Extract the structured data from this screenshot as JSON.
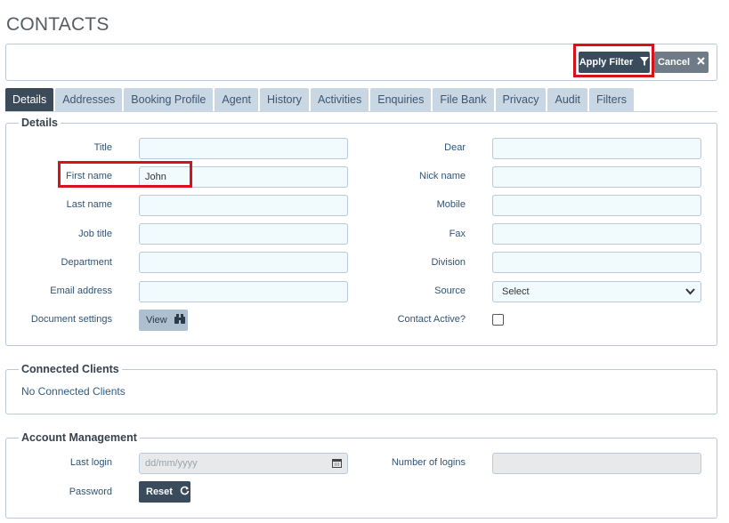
{
  "page": {
    "title": "CONTACTS"
  },
  "toolbar": {
    "apply_filter_label": "Apply Filter",
    "cancel_label": "Cancel"
  },
  "tabs": [
    {
      "label": "Details",
      "active": true
    },
    {
      "label": "Addresses"
    },
    {
      "label": "Booking Profile"
    },
    {
      "label": "Agent"
    },
    {
      "label": "History"
    },
    {
      "label": "Activities"
    },
    {
      "label": "Enquiries"
    },
    {
      "label": "File Bank"
    },
    {
      "label": "Privacy"
    },
    {
      "label": "Audit"
    },
    {
      "label": "Filters"
    }
  ],
  "details": {
    "legend": "Details",
    "title_label": "Title",
    "title_value": "",
    "first_name_label": "First name",
    "first_name_value": "John",
    "last_name_label": "Last name",
    "last_name_value": "",
    "job_title_label": "Job title",
    "job_title_value": "",
    "department_label": "Department",
    "department_value": "",
    "email_label": "Email address",
    "email_value": "",
    "document_settings_label": "Document settings",
    "view_button_label": "View",
    "dear_label": "Dear",
    "dear_value": "",
    "nick_name_label": "Nick name",
    "nick_name_value": "",
    "mobile_label": "Mobile",
    "mobile_value": "",
    "fax_label": "Fax",
    "fax_value": "",
    "division_label": "Division",
    "division_value": "",
    "source_label": "Source",
    "source_selected": "Select",
    "contact_active_label": "Contact Active?",
    "contact_active_checked": false
  },
  "connected_clients": {
    "legend": "Connected Clients",
    "empty_text": "No Connected Clients"
  },
  "account_management": {
    "legend": "Account Management",
    "last_login_label": "Last login",
    "last_login_placeholder": "dd/mm/yyyy",
    "number_of_logins_label": "Number of logins",
    "number_of_logins_value": "",
    "password_label": "Password",
    "reset_button_label": "Reset"
  },
  "colors": {
    "accent_dark": "#3a4c5c",
    "tab_inactive": "#c9d7e5",
    "input_bg": "#f1fbfd",
    "highlight": "#d8121b"
  },
  "icons": {
    "filter": "filter-icon",
    "cancel": "close-icon",
    "view": "binoculars-icon",
    "calendar": "calendar-icon",
    "reset": "refresh-icon",
    "select": "chevron-down-icon"
  }
}
